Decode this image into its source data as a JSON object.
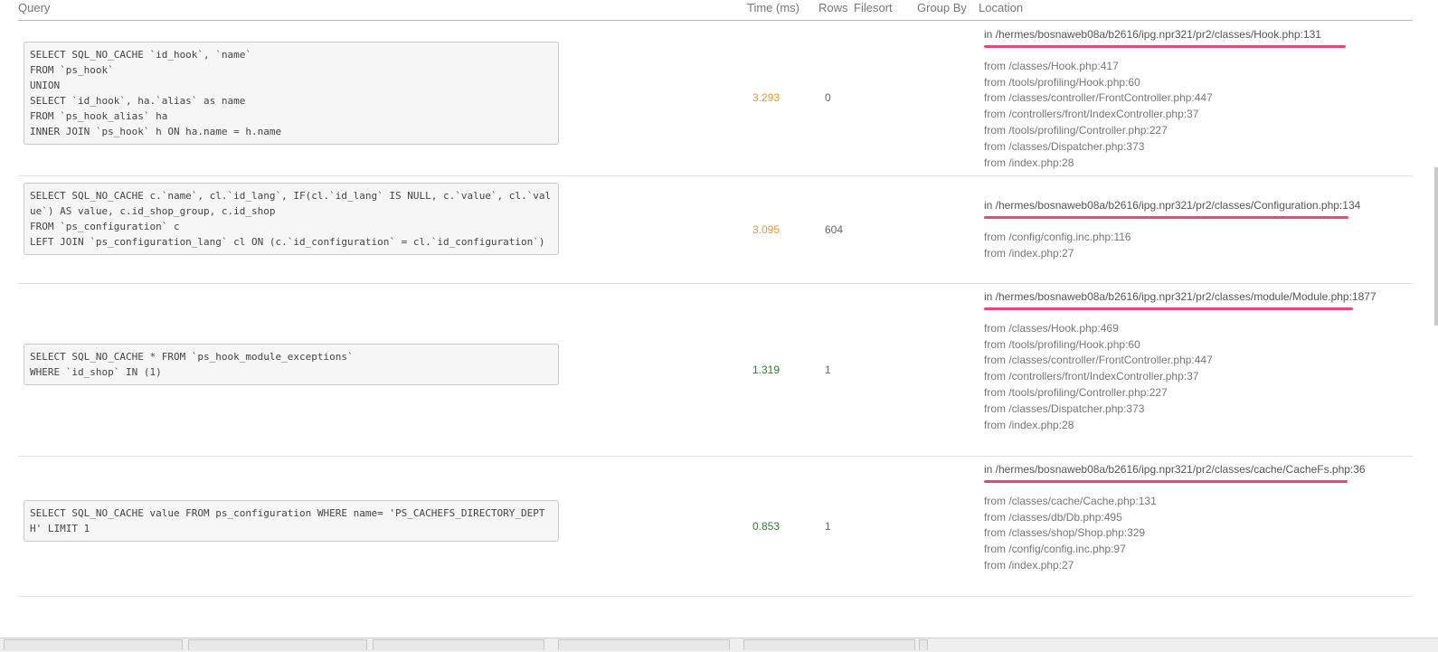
{
  "header": {
    "query": "Query",
    "time": "Time (ms)",
    "rows": "Rows",
    "filesort": "Filesort",
    "group_by": "Group By",
    "location": "Location"
  },
  "queries": [
    {
      "sql": "SELECT SQL_NO_CACHE `id_hook`, `name`\nFROM `ps_hook`\nUNION\nSELECT `id_hook`, ha.`alias` as name\nFROM `ps_hook_alias` ha\nINNER JOIN `ps_hook` h ON ha.name = h.name",
      "time": "3.293",
      "time_color": "#e69a2a",
      "rows": "0",
      "location_in": "in /hermes/bosnaweb08a/b2616/ipg.npr321/pr2/classes/Hook.php:131",
      "frames": [
        "from /classes/Hook.php:417",
        "from /tools/profiling/Hook.php:60",
        "from /classes/controller/FrontController.php:447",
        "from /controllers/front/IndexController.php:37",
        "from /tools/profiling/Controller.php:227",
        "from /classes/Dispatcher.php:373",
        "from /index.php:28"
      ]
    },
    {
      "sql": "SELECT SQL_NO_CACHE c.`name`, cl.`id_lang`, IF(cl.`id_lang` IS NULL, c.`value`, cl.`value`) AS value, c.id_shop_group, c.id_shop\nFROM `ps_configuration` c\nLEFT JOIN `ps_configuration_lang` cl ON (c.`id_configuration` = cl.`id_configuration`)",
      "time": "3.095",
      "time_color": "#e69a2a",
      "rows": "604",
      "location_in": "in /hermes/bosnaweb08a/b2616/ipg.npr321/pr2/classes/Configuration.php:134",
      "frames": [
        "from /config/config.inc.php:116",
        "from /index.php:27"
      ]
    },
    {
      "sql": "SELECT SQL_NO_CACHE * FROM `ps_hook_module_exceptions`\nWHERE `id_shop` IN (1)",
      "time": "1.319",
      "time_color": "#2e7d32",
      "rows": "1",
      "location_in": "in /hermes/bosnaweb08a/b2616/ipg.npr321/pr2/classes/module/Module.php:1877",
      "frames": [
        "from /classes/Hook.php:469",
        "from /tools/profiling/Hook.php:60",
        "from /classes/controller/FrontController.php:447",
        "from /controllers/front/IndexController.php:37",
        "from /tools/profiling/Controller.php:227",
        "from /classes/Dispatcher.php:373",
        "from /index.php:28"
      ]
    },
    {
      "sql": "SELECT SQL_NO_CACHE value FROM ps_configuration WHERE name= 'PS_CACHEFS_DIRECTORY_DEPTH' LIMIT 1",
      "time": "0.853",
      "time_color": "#2e7d32",
      "rows": "1",
      "location_in": "in /hermes/bosnaweb08a/b2616/ipg.npr321/pr2/classes/cache/CacheFs.php:36",
      "frames": [
        "from /classes/cache/Cache.php:131",
        "from /classes/db/Db.php:495",
        "from /classes/shop/Shop.php:329",
        "from /config/config.inc.php:97",
        "from /index.php:27"
      ]
    }
  ]
}
